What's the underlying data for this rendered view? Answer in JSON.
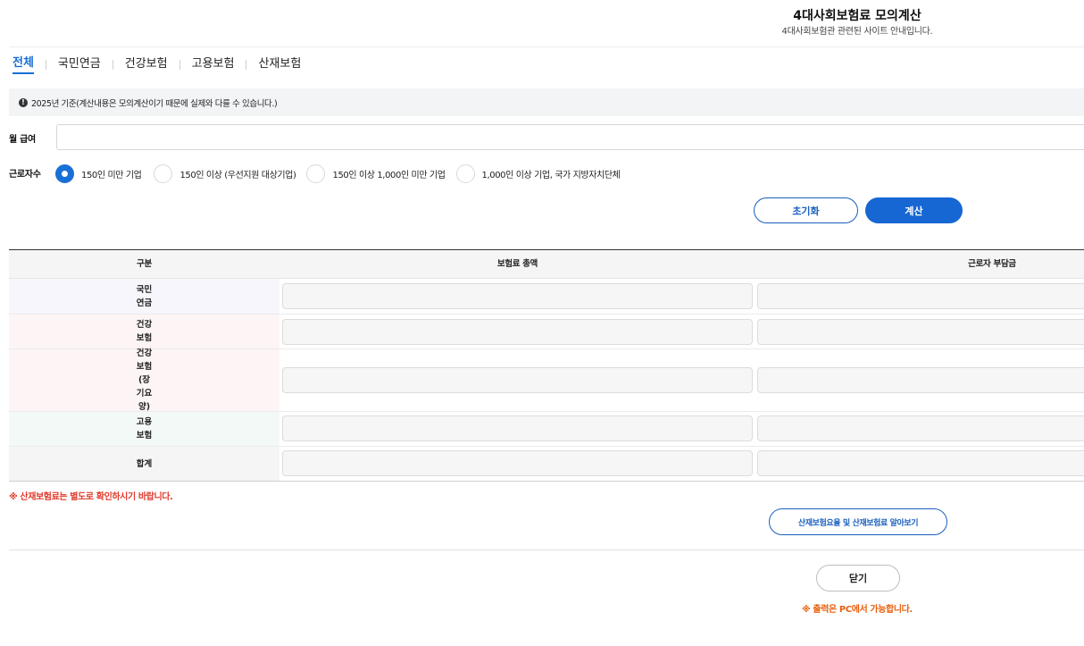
{
  "header": {
    "title": "4대사회보험료 모의계산",
    "subtitle": "4대사회보험관 관련된 사이트 안내입니다."
  },
  "tabs": [
    {
      "label": "전체",
      "active": true
    },
    {
      "label": "국민연금",
      "active": false
    },
    {
      "label": "건강보험",
      "active": false
    },
    {
      "label": "고용보험",
      "active": false
    },
    {
      "label": "산재보험",
      "active": false
    }
  ],
  "notice": {
    "icon": "exclamation-circle-icon",
    "text": "2025년 기준(계산내용은 모의계산이기 때문에 실제와 다를 수 있습니다.)"
  },
  "form": {
    "salary_label": "월 급여",
    "salary_value": "",
    "workers_label": "근로자수",
    "options": [
      {
        "label": "150인 미만 기업",
        "checked": true
      },
      {
        "label": "150인 이상 (우선지원 대상기업)",
        "checked": false
      },
      {
        "label": "150인 이상 1,000인 미만 기업",
        "checked": false
      },
      {
        "label": "1,000인 이상 기업, 국가 지방자치단체",
        "checked": false
      }
    ],
    "reset_label": "초기화",
    "calc_label": "계산"
  },
  "table": {
    "headers": [
      "구분",
      "보험료 총액",
      "근로자 부담금"
    ],
    "rows": [
      {
        "label": "국민연금",
        "bg": "#f6f6fc"
      },
      {
        "label": "건강보험",
        "bg": "#fdf5f5"
      },
      {
        "label": "건강보험(장기요양)",
        "bg": "#fdf5f5"
      },
      {
        "label": "고용보험",
        "bg": "#f3f9f6"
      },
      {
        "label": "합계",
        "bg": "#f5f5f5"
      }
    ]
  },
  "footer": {
    "warning_red": "※ 산재보험료는 별도로 확인하시기 바랍니다.",
    "info_button": "산재보험요율 및 산재보험료 알아보기",
    "close_label": "닫기",
    "warning_orange": "※ 출력은 PC에서 가능합니다."
  },
  "colors": {
    "accent": "#1667d3",
    "red": "#e03a2c",
    "orange": "#e8600f"
  }
}
